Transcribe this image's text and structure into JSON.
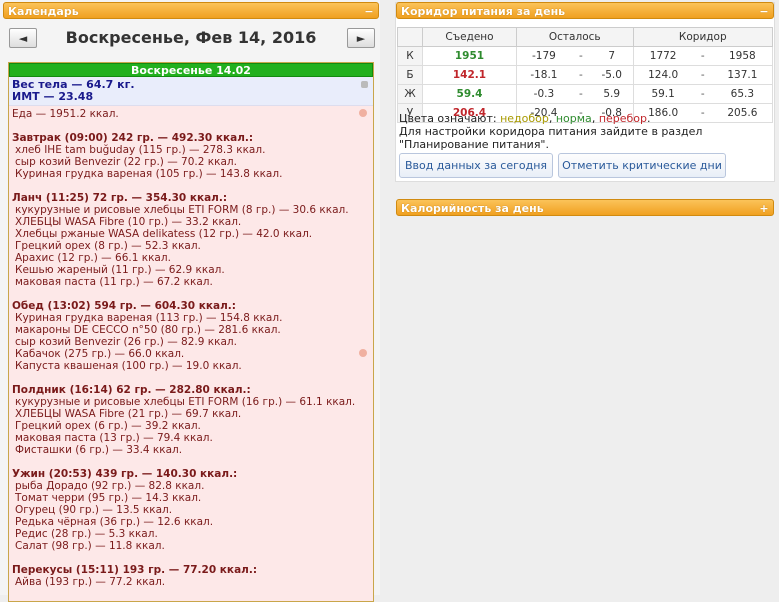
{
  "calendar": {
    "header": "Календарь",
    "toggle": "−",
    "prev": "◄",
    "next": "►",
    "date_title": "Воскресенье, Фев 14, 2016",
    "day_bar": "Воскресенье 14.02",
    "weight_line": "Вес тела — 64.7 кг.",
    "bmi_line": "ИМТ — 23.48",
    "food_total": "Еда — 1951.2 ккал.",
    "meals": [
      {
        "title": "Завтрак (09:00) 242 гр. — 492.30 ккал.:",
        "items": [
          "хлеб IHE tam buğuday (115 гр.) — 278.3 ккал.",
          "сыр козий Benvezir (22 гр.) — 70.2 ккал.",
          "Куриная грудка вареная (105 гр.) — 143.8 ккал."
        ]
      },
      {
        "title": "Ланч (11:25) 72 гр. — 354.30 ккал.:",
        "items": [
          "кукурузные и рисовые хлебцы ETI FORM (8 гр.) — 30.6 ккал.",
          "ХЛЕБЦЫ WASA Fibre (10 гр.) — 33.2 ккал.",
          "Хлебцы ржаные WASA delikatess (12 гр.) — 42.0 ккал.",
          "Грецкий орех (8 гр.) — 52.3 ккал.",
          "Арахис (12 гр.) — 66.1 ккал.",
          "Кешью жареный (11 гр.) — 62.9 ккал.",
          "маковая паста (11 гр.) — 67.2 ккал."
        ]
      },
      {
        "title": "Обед (13:02) 594 гр. — 604.30 ккал.:",
        "items": [
          "Куриная грудка вареная (113 гр.) — 154.8 ккал.",
          "макароны DE CECCO n°50 (80 гр.) — 281.6 ккал.",
          "сыр козий Benvezir (26 гр.) — 82.9 ккал.",
          "Кабачок (275 гр.) — 66.0 ккал.",
          "Капуста квашеная (100 гр.) — 19.0 ккал."
        ]
      },
      {
        "title": "Полдник (16:14) 62 гр. — 282.80 ккал.:",
        "items": [
          "кукурузные и рисовые хлебцы ETI FORM (16 гр.) — 61.1 ккал.",
          "ХЛЕБЦЫ WASA Fibre (21 гр.) — 69.7 ккал.",
          "Грецкий орех (6 гр.) — 39.2 ккал.",
          "маковая паста (13 гр.) — 79.4 ккал.",
          "Фисташки (6 гр.) — 33.4 ккал."
        ]
      },
      {
        "title": "Ужин (20:53) 439 гр. — 140.30 ккал.:",
        "items": [
          "рыба Дорадо (92 гр.) — 82.8 ккал.",
          "Томат черри (95 гр.) — 14.3 ккал.",
          "Огурец (90 гр.) — 13.5 ккал.",
          "Редька чёрная (36 гр.) — 12.6 ккал.",
          "Редис (28 гр.) — 5.3 ккал.",
          "Салат (98 гр.) — 11.8 ккал."
        ]
      },
      {
        "title": "Перекусы (15:11) 193 гр. — 77.20 ккал.:",
        "items": [
          "Айва (193 гр.) — 77.2 ккал."
        ]
      }
    ]
  },
  "corridor": {
    "header": "Коридор питания за день",
    "toggle": "−",
    "columns": {
      "eaten": "Съедено",
      "left": "Осталось",
      "corridor": "Коридор"
    },
    "rows": [
      {
        "label": "К",
        "eaten": "1951",
        "eaten_color": "#2e8b2e",
        "left_a": "-179",
        "left_b": "7",
        "c_a": "1772",
        "c_b": "1958"
      },
      {
        "label": "Б",
        "eaten": "142.1",
        "eaten_color": "#c0262b",
        "left_a": "-18.1",
        "left_b": "-5.0",
        "c_a": "124.0",
        "c_b": "137.1"
      },
      {
        "label": "Ж",
        "eaten": "59.4",
        "eaten_color": "#2e8b2e",
        "left_a": "-0.3",
        "left_b": "5.9",
        "c_a": "59.1",
        "c_b": "65.3"
      },
      {
        "label": "У",
        "eaten": "206.4",
        "eaten_color": "#c0262b",
        "left_a": "-20.4",
        "left_b": "-0.8",
        "c_a": "186.0",
        "c_b": "205.6"
      }
    ],
    "dash": "-",
    "legend_prefix": "Цвета означают:",
    "legend_under": "недобор",
    "legend_norm": "норма",
    "legend_over": "перебор",
    "legend_under_color": "#a89a00",
    "legend_norm_color": "#2e8b2e",
    "legend_over_color": "#c0262b",
    "settings_line1": "Для настройки коридора питания зайдите в раздел",
    "settings_line2": "\"Планирование питания\".",
    "btn_today": "Ввод данных за сегодня",
    "btn_critical": "Отметить критические дни"
  },
  "calories": {
    "header": "Калорийность за день",
    "toggle": "+"
  }
}
